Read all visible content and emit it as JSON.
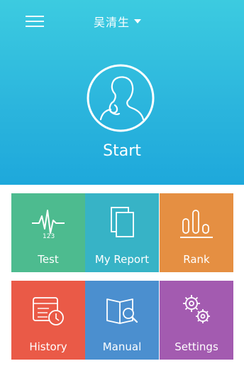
{
  "header": {
    "user_name": "吴清生",
    "user_dropdown_icon": "caret-down-icon",
    "menu_icon": "hamburger-menu-icon"
  },
  "hero": {
    "start_label": "Start",
    "avatar_icon": "person-profile-icon"
  },
  "tiles": [
    {
      "label": "Test",
      "icon": "heartbeat-123-icon",
      "color": "#4dbb8f"
    },
    {
      "label": "My Report",
      "icon": "documents-icon",
      "color": "#37b3c6"
    },
    {
      "label": "Rank",
      "icon": "rank-bars-icon",
      "color": "#e58f42"
    },
    {
      "label": "History",
      "icon": "calendar-clock-icon",
      "color": "#ea5a47"
    },
    {
      "label": "Manual",
      "icon": "book-search-icon",
      "color": "#4b8fcf"
    },
    {
      "label": "Settings",
      "icon": "gears-icon",
      "color": "#a35bb0"
    }
  ],
  "colors": {
    "hero_top": "#3ccbe0",
    "hero_bottom": "#1ea8db"
  }
}
